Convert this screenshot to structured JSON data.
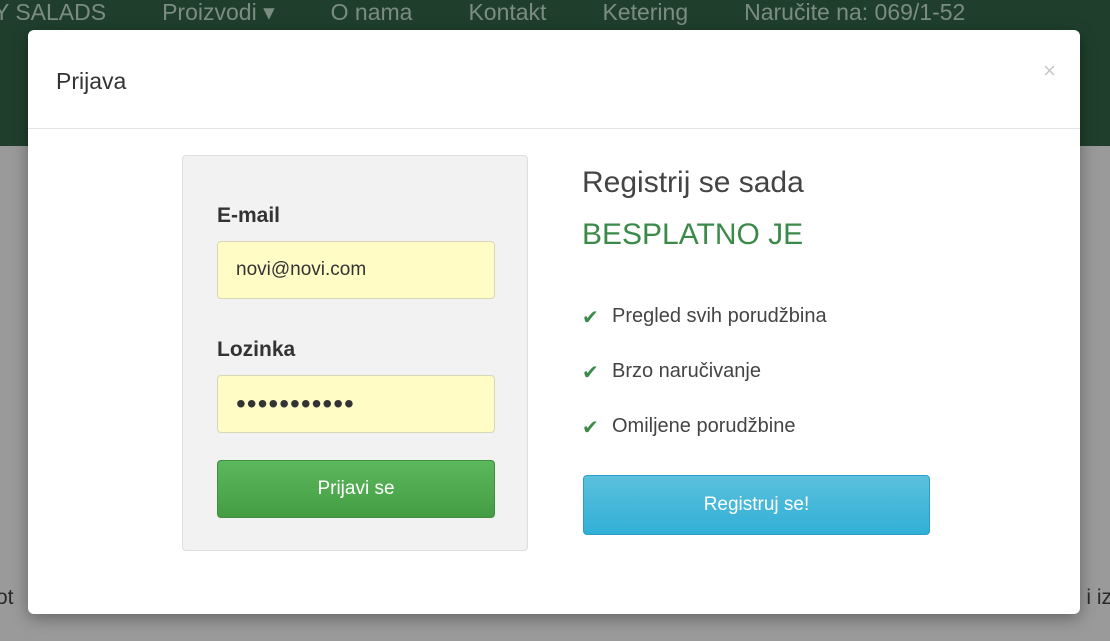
{
  "navbar": {
    "brand": "Y SALADS",
    "items": [
      "Proizvodi ▾",
      "O nama",
      "Kontakt",
      "Ketering",
      "Naručite na: 069/1-52"
    ]
  },
  "background": {
    "left_fragment": "ot",
    "right_fragment": "i iz"
  },
  "modal": {
    "title": "Prijava",
    "close_label": "×"
  },
  "login": {
    "email_label": "E-mail",
    "email_value": "novi@novi.com",
    "password_label": "Lozinka",
    "password_value": "•••••••••••",
    "submit_label": "Prijavi se"
  },
  "register": {
    "title": "Registrij se sada",
    "subtitle": "BESPLATNO JE",
    "benefits": [
      "Pregled svih porudžbina",
      "Brzo naručivanje",
      "Omiljene porudžbine"
    ],
    "button_label": "Registruj se!"
  },
  "colors": {
    "accent_green": "#3c8a4a",
    "login_button": "#5cb85c",
    "register_button": "#5bc0de",
    "input_autofill": "#fffcc6"
  }
}
